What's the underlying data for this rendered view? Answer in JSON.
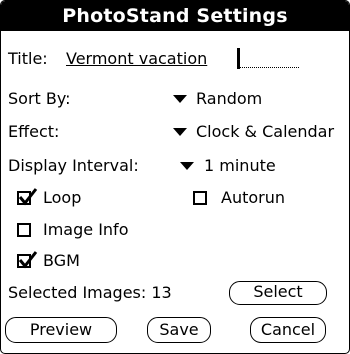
{
  "window": {
    "title": "PhotoStand Settings"
  },
  "title_field": {
    "label": "Title:",
    "value": "Vermont vacation"
  },
  "sort_by": {
    "label": "Sort By:",
    "value": "Random"
  },
  "effect": {
    "label": "Effect:",
    "value": "Clock & Calendar"
  },
  "display_interval": {
    "label": "Display Interval:",
    "value": "1 minute"
  },
  "checkboxes": {
    "loop": {
      "label": "Loop",
      "checked": true
    },
    "autorun": {
      "label": "Autorun",
      "checked": false
    },
    "image_info": {
      "label": "Image Info",
      "checked": false
    },
    "bgm": {
      "label": "BGM",
      "checked": true
    }
  },
  "selected_images": {
    "label": "Selected Images:",
    "count": "13"
  },
  "buttons": {
    "select": "Select",
    "preview": "Preview",
    "save": "Save",
    "cancel": "Cancel"
  }
}
